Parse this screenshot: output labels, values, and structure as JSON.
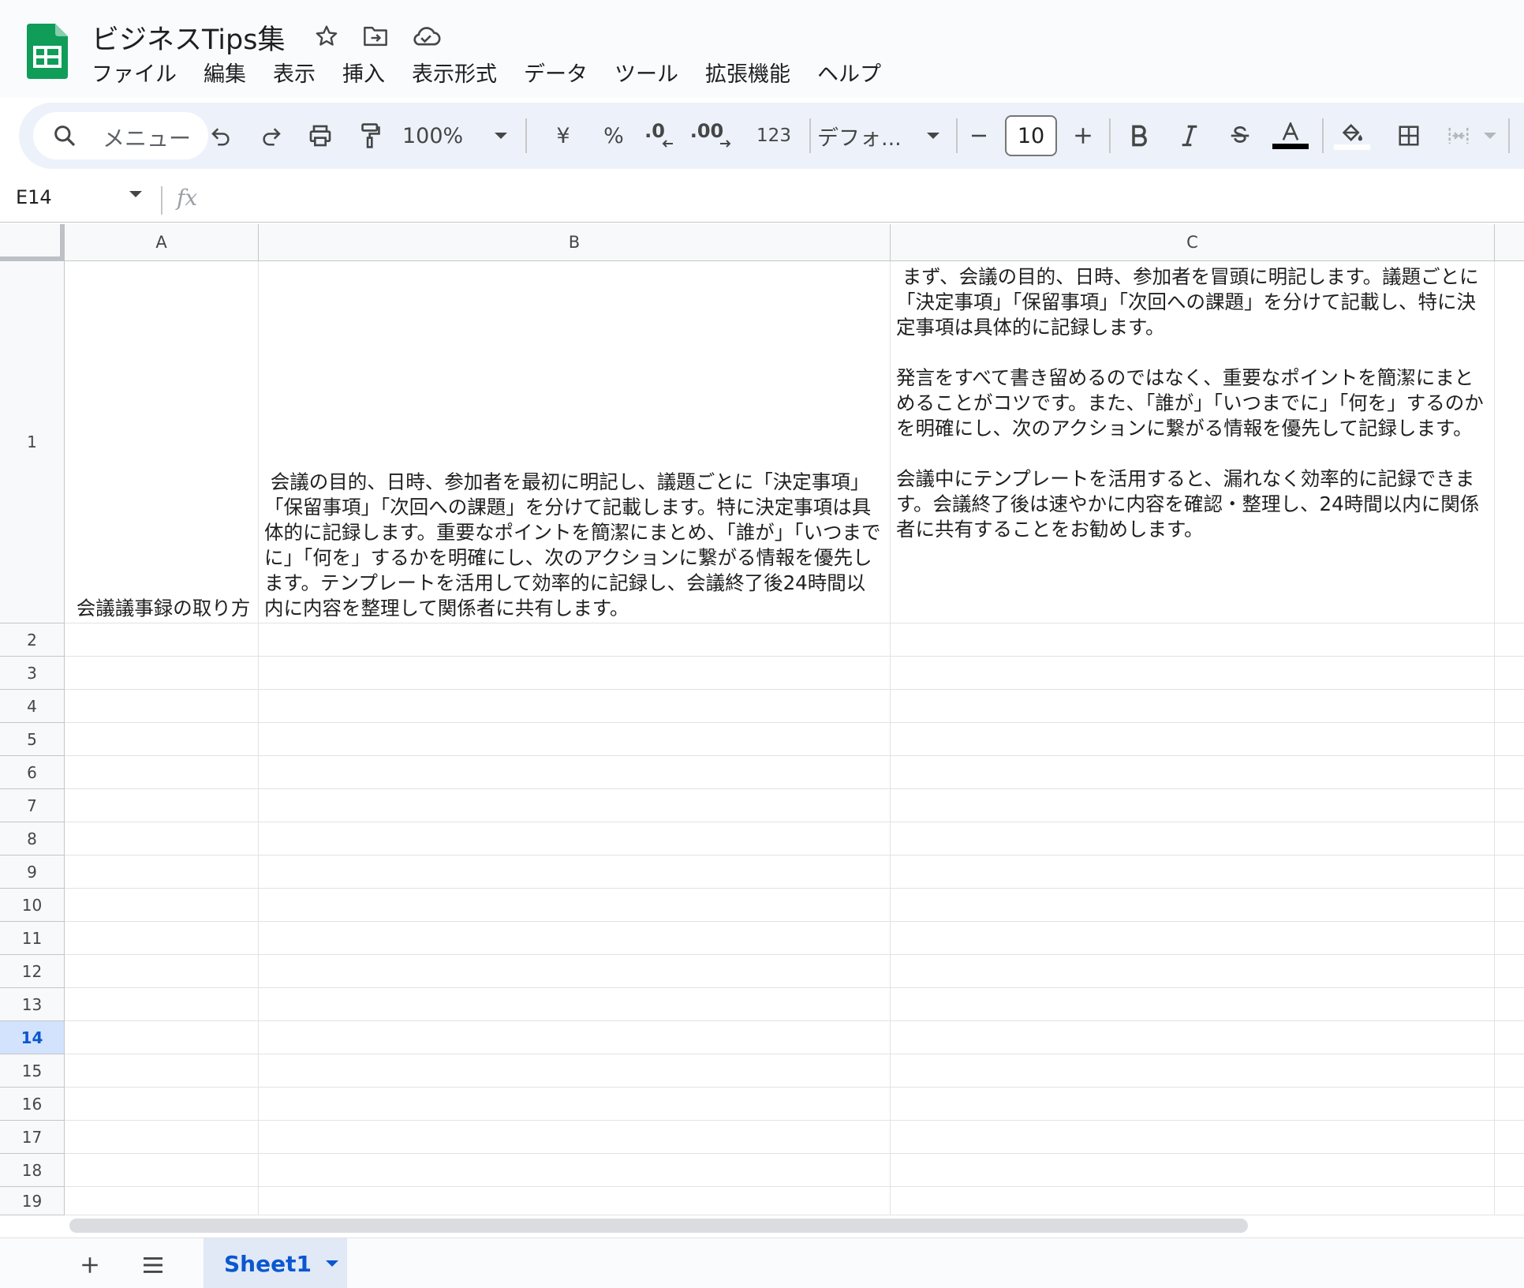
{
  "app": {
    "title": "ビジネスTips集",
    "brand_color": "#0f9d58"
  },
  "menu": {
    "items": [
      "ファイル",
      "編集",
      "表示",
      "挿入",
      "表示形式",
      "データ",
      "ツール",
      "拡張機能",
      "ヘルプ"
    ]
  },
  "toolbar": {
    "search_label": "メニュー",
    "zoom": "100%",
    "currency": "¥",
    "percent": "%",
    "decimal_decrease": ".0",
    "decimal_increase": ".00",
    "number_format": "123",
    "font": "デフォ...",
    "font_size": "10"
  },
  "formula_bar": {
    "cell_ref": "E14",
    "fx": "fx",
    "value": ""
  },
  "grid": {
    "columns": [
      "A",
      "B",
      "C"
    ],
    "rows": [
      "1",
      "2",
      "3",
      "4",
      "5",
      "6",
      "7",
      "8",
      "9",
      "10",
      "11",
      "12",
      "13",
      "14",
      "15",
      "16",
      "17",
      "18",
      "19"
    ],
    "selected_row": "14",
    "cells": {
      "A1": " 会議議事録の取り方",
      "B1": " 会議の目的、日時、参加者を最初に明記し、議題ごとに「決定事項」「保留事項」「次回への課題」を分けて記載します。特に決定事項は具体的に記録します。重要なポイントを簡潔にまとめ、「誰が」「いつまでに」「何を」するかを明確にし、次のアクションに繋がる情報を優先します。テンプレートを活用して効率的に記録し、会議終了後24時間以内に内容を整理して関係者に共有します。",
      "C1": " まず、会議の目的、日時、参加者を冒頭に明記します。議題ごとに「決定事項」「保留事項」「次回への課題」を分けて記載し、特に決定事項は具体的に記録します。\n\n発言をすべて書き留めるのではなく、重要なポイントを簡潔にまとめることがコツです。また、「誰が」「いつまでに」「何を」するのかを明確にし、次のアクションに繋がる情報を優先して記録します。\n\n会議中にテンプレートを活用すると、漏れなく効率的に記録できます。会議終了後は速やかに内容を確認・整理し、24時間以内に関係者に共有することをお勧めします。"
    }
  },
  "sheets": {
    "tabs": [
      "Sheet1"
    ],
    "active": "Sheet1"
  }
}
